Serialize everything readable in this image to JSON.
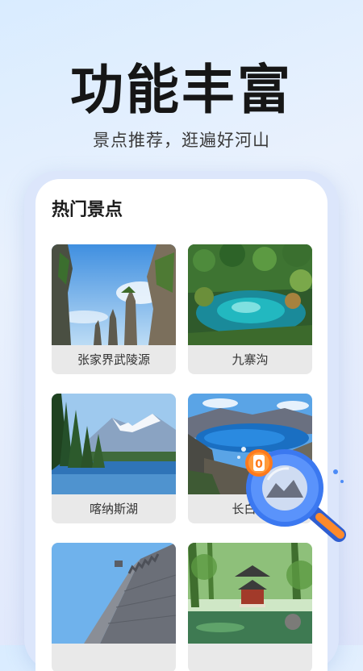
{
  "promo": {
    "headline": "功能丰富",
    "subheadline": "景点推荐，逛遍好河山"
  },
  "section": {
    "title": "热门景点"
  },
  "spots": [
    {
      "name": "张家界武陵源"
    },
    {
      "name": "九寨沟"
    },
    {
      "name": "喀纳斯湖"
    },
    {
      "name": "长白山"
    },
    {
      "name": ""
    },
    {
      "name": ""
    }
  ],
  "badge": {
    "count": "0"
  },
  "colors": {
    "accent_blue": "#3d7df5",
    "badge_orange": "#f47a1f",
    "card_label_bg": "#e9e9e9"
  }
}
